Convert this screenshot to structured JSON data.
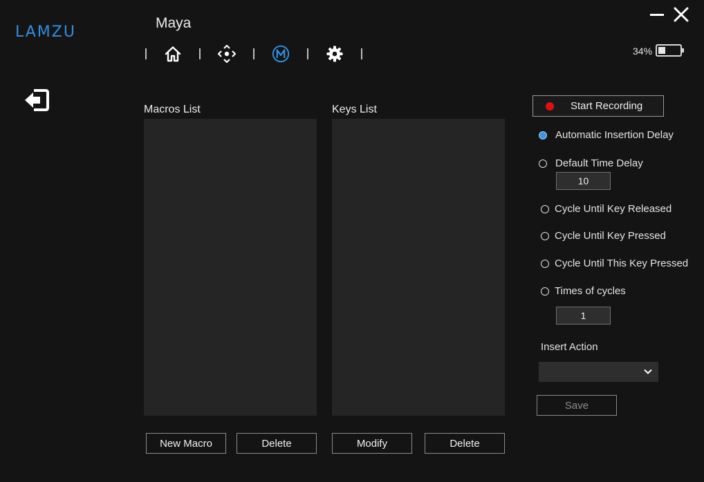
{
  "brand": {
    "logo_text": "LAMZU",
    "accent_color": "#2f8fe0"
  },
  "profile": {
    "name": "Maya"
  },
  "nav": {
    "items": [
      {
        "icon": "home-icon",
        "active": false
      },
      {
        "icon": "dpad-icon",
        "active": false
      },
      {
        "icon": "macro-icon",
        "label": "M",
        "active": true
      },
      {
        "icon": "gear-icon",
        "active": false
      }
    ]
  },
  "battery": {
    "percent_text": "34%",
    "level": 0.34
  },
  "macros": {
    "title": "Macros List",
    "items": [],
    "new_label": "New Macro",
    "delete_label": "Delete"
  },
  "keys": {
    "title": "Keys List",
    "items": [],
    "modify_label": "Modify",
    "delete_label": "Delete"
  },
  "recording": {
    "start_label": "Start Recording",
    "dot_color": "#e01010"
  },
  "delay": {
    "automatic_label": "Automatic Insertion Delay",
    "default_label": "Default Time Delay",
    "default_value": "10",
    "selected": "automatic"
  },
  "cycles": {
    "until_released_label": "Cycle Until Key Released",
    "until_pressed_label": "Cycle Until Key Pressed",
    "until_this_pressed_label": "Cycle Until This Key Pressed",
    "times_label": "Times of cycles",
    "times_value": "1"
  },
  "insert_action": {
    "label": "Insert Action",
    "value": ""
  },
  "save_label": "Save"
}
